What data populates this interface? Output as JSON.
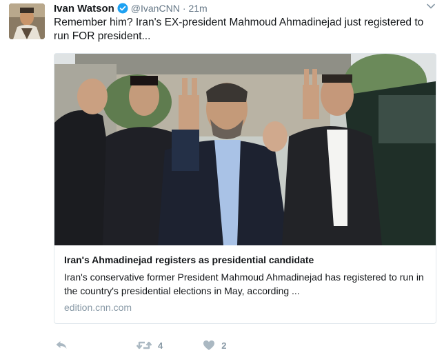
{
  "tweet": {
    "author_name": "Ivan Watson",
    "handle": "@IvanCNN",
    "separator": "·",
    "time": "21m",
    "text": "Remember him?  Iran's EX-president Mahmoud Ahmadinejad just registered to run FOR president..."
  },
  "card": {
    "title": "Iran's Ahmadinejad registers as presidential candidate",
    "description": "Iran's conservative former President Mahmoud Ahmadinejad has registered to run in the country's presidential elections in May, according ...",
    "domain": "edition.cnn.com"
  },
  "actions": {
    "retweet_count": "4",
    "like_count": "2"
  },
  "icons": {
    "verified": "verified-badge-icon",
    "menu": "chevron-down-icon",
    "reply": "reply-icon",
    "retweet": "retweet-icon",
    "like": "heart-icon"
  },
  "colors": {
    "verified_blue": "#1da1f2",
    "secondary_text": "#657786",
    "action_gray": "#aab8c2",
    "domain_gray": "#8899a6"
  }
}
